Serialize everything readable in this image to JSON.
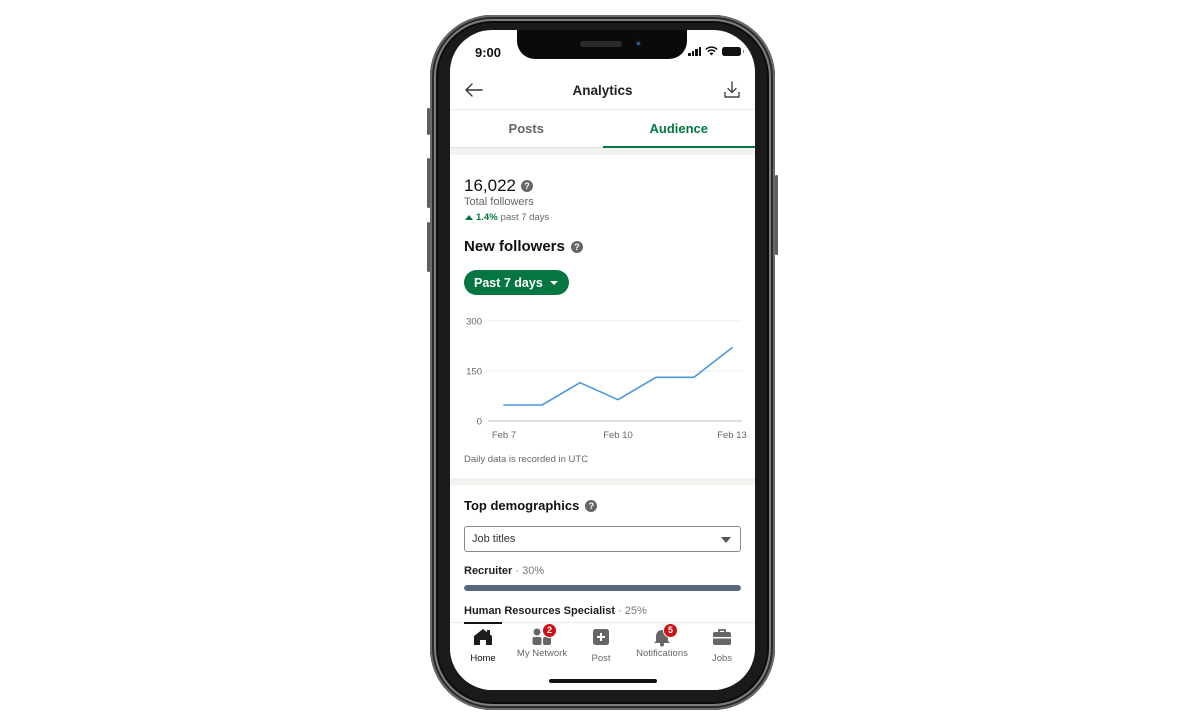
{
  "status_bar": {
    "time": "9:00",
    "icons": [
      "signal-icon",
      "wifi-icon",
      "battery-icon"
    ]
  },
  "app_bar": {
    "title": "Analytics",
    "back_icon": "arrow-left-icon",
    "action_icon": "download-icon"
  },
  "tabs": [
    {
      "label": "Posts",
      "active": false
    },
    {
      "label": "Audience",
      "active": true
    }
  ],
  "summary": {
    "total_followers": "16,022",
    "total_label": "Total followers",
    "trend_pct": "1.4%",
    "trend_period": "past 7 days",
    "help_glyph": "?"
  },
  "new_followers": {
    "title": "New followers",
    "range_label": "Past 7 days",
    "note": "Daily data is recorded in UTC"
  },
  "chart_data": {
    "type": "line",
    "title": "New followers",
    "x": [
      "Feb 7",
      "Feb 8",
      "Feb 9",
      "Feb 10",
      "Feb 11",
      "Feb 12",
      "Feb 13"
    ],
    "xticks": [
      "Feb 7",
      "Feb 10",
      "Feb 13"
    ],
    "series": [
      {
        "name": "New followers",
        "values": [
          48,
          48,
          115,
          64,
          131,
          131,
          220
        ]
      }
    ],
    "yticks": [
      "300",
      "150",
      "0"
    ],
    "ylim": [
      0,
      300
    ],
    "grid": true,
    "line_color": "#4a98e0",
    "xlabel": "",
    "ylabel": ""
  },
  "demographics": {
    "title": "Top demographics",
    "select_value": "Job titles",
    "rows": [
      {
        "label": "Recruiter",
        "pct_text": "30%",
        "pct": 30
      },
      {
        "label": "Human Resources Specialist",
        "pct_text": "25%",
        "pct": 25
      }
    ]
  },
  "bottom_nav": [
    {
      "label": "Home",
      "icon": "home-icon",
      "active": true,
      "badge": ""
    },
    {
      "label": "My Network",
      "icon": "network-icon",
      "active": false,
      "badge": "2"
    },
    {
      "label": "Post",
      "icon": "post-icon",
      "active": false,
      "badge": ""
    },
    {
      "label": "Notifications",
      "icon": "bell-icon",
      "active": false,
      "badge": "5"
    },
    {
      "label": "Jobs",
      "icon": "briefcase-icon",
      "active": false,
      "badge": ""
    }
  ],
  "colors": {
    "brand_green": "#057642",
    "chart_line": "#4a98e0",
    "badge_red": "#cc1016",
    "bar_fill": "#56687a"
  }
}
